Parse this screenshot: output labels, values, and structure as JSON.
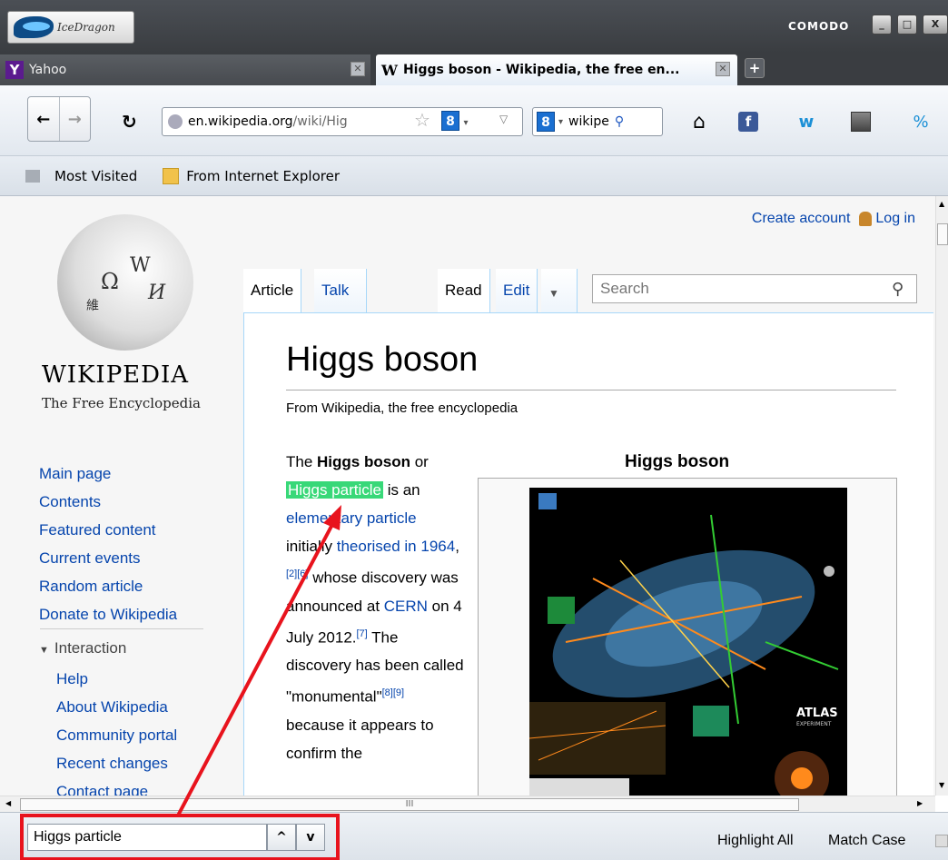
{
  "browser": {
    "app_name": "IceDragon",
    "brand": "COMODO",
    "window_buttons": [
      "_",
      "□",
      "X"
    ]
  },
  "tabs": [
    {
      "label": "Yahoo",
      "favicon": "Y"
    },
    {
      "label": "Higgs boson - Wikipedia, the free en...",
      "favicon": "W"
    }
  ],
  "nav": {
    "url_host": "en.wikipedia.org",
    "url_path": "/wiki/Hig",
    "search_engine_badge": "8",
    "search_text": "wikipe"
  },
  "bookmarks": [
    "Most Visited",
    "From Internet Explorer"
  ],
  "wiki": {
    "create_account": "Create account",
    "log_in": "Log in",
    "wordmark": "WIKIPEDIA",
    "tagline": "The Free Encyclopedia",
    "main_nav": [
      "Main page",
      "Contents",
      "Featured content",
      "Current events",
      "Random article",
      "Donate to Wikipedia"
    ],
    "interaction_label": "Interaction",
    "interaction_links": [
      "Help",
      "About Wikipedia",
      "Community portal",
      "Recent changes",
      "Contact page"
    ],
    "tab_article": "Article",
    "tab_talk": "Talk",
    "tab_read": "Read",
    "tab_edit": "Edit",
    "search_placeholder": "Search",
    "title": "Higgs boson",
    "subtitle": "From Wikipedia, the free encyclopedia",
    "infobox_title": "Higgs boson",
    "atlas_label": "ATLAS",
    "atlas_sublabel": "EXPERIMENT",
    "body": {
      "p1": "The ",
      "bold": "Higgs boson",
      "p2": " or",
      "highlight": "Higgs particle",
      "p3": " is an",
      "link1": "elementary particle",
      "p4": "initially ",
      "link2": "theorised in 1964",
      "cite1": "[2][6]",
      "p5": " whose discovery was announced at ",
      "link3": "CERN",
      "p6": " on 4 July 2012.",
      "cite2": "[7]",
      "p7": " The discovery has been called \"monumental\"",
      "cite3": "[8][9]",
      "p8": " because it appears to confirm the"
    }
  },
  "findbar": {
    "query": "Higgs particle",
    "up": "^",
    "down": "v",
    "highlight_all": "Highlight All",
    "match_case": "Match Case"
  },
  "scrollbar_grip": "III"
}
